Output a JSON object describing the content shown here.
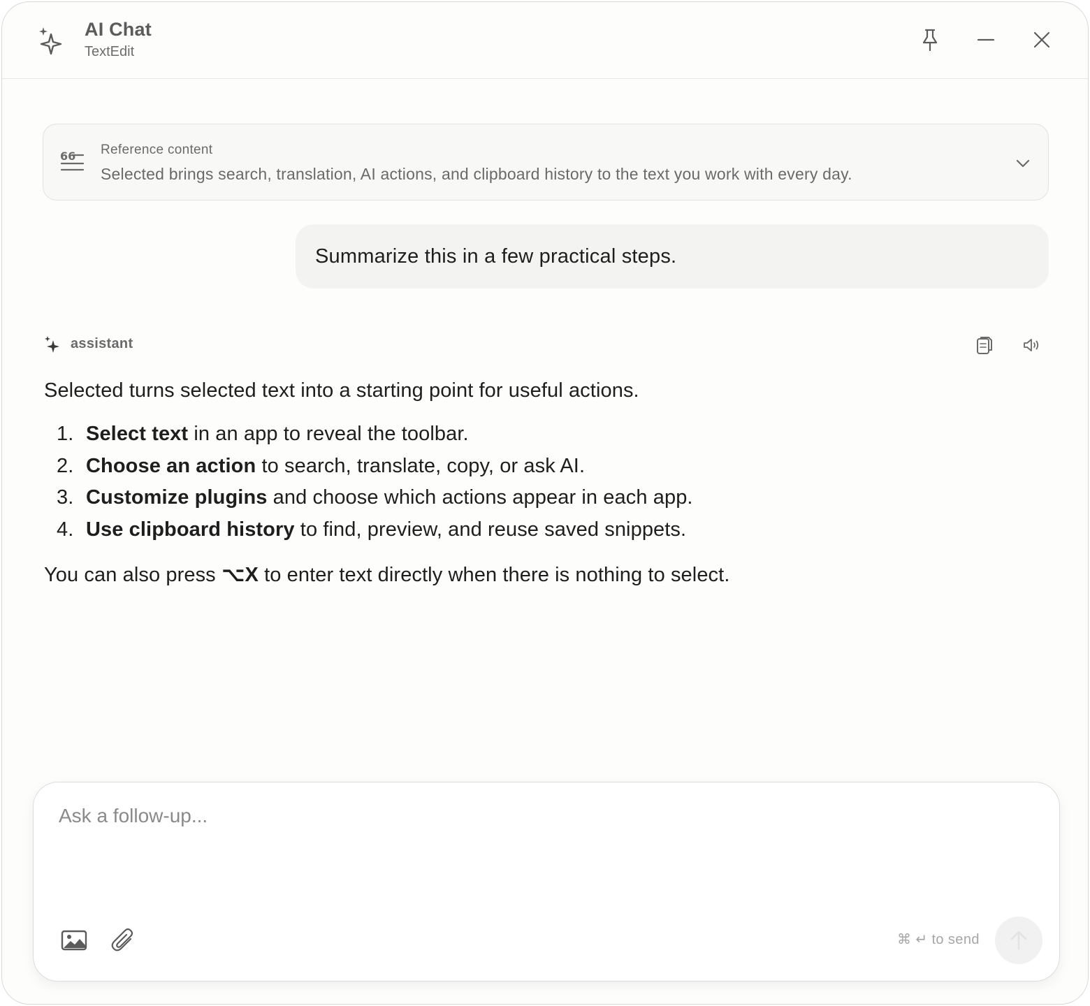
{
  "header": {
    "title": "AI Chat",
    "subtitle": "TextEdit",
    "icons": {
      "app": "sparkles-icon",
      "pin": "pin-icon",
      "minimize": "minimize-icon",
      "close": "close-icon"
    }
  },
  "reference": {
    "label": "Reference content",
    "text": "Selected brings search, translation, AI actions, and clipboard history to the text you work with every day.",
    "icons": {
      "quote": "quote-icon",
      "expand": "chevron-down-icon"
    }
  },
  "user_message": {
    "text": "Summarize this in a few practical steps."
  },
  "assistant": {
    "role": "assistant",
    "intro": "Selected turns selected text into a starting point for useful actions.",
    "steps": [
      {
        "number": "1.",
        "bold": "Select text",
        "rest": " in an app to reveal the toolbar."
      },
      {
        "number": "2.",
        "bold": "Choose an action",
        "rest": " to search, translate, copy, or ask AI."
      },
      {
        "number": "3.",
        "bold": "Customize plugins",
        "rest": " and choose which actions appear in each app."
      },
      {
        "number": "4.",
        "bold": "Use clipboard history",
        "rest": " to find, preview, and reuse saved snippets."
      }
    ],
    "outro_before": "You can also press ",
    "outro_shortcut": "⌥X",
    "outro_after": " to enter text directly when there is nothing to select.",
    "icons": {
      "avatar": "sparkle-icon",
      "copy": "copy-icon",
      "speak": "speaker-icon"
    }
  },
  "composer": {
    "placeholder": "Ask a follow-up...",
    "value": "",
    "send_hint": "⌘ ↵ to send",
    "icons": {
      "image": "image-icon",
      "attach": "paperclip-icon",
      "send": "arrow-up-icon"
    }
  },
  "colors": {
    "window_bg": "#fdfdfc",
    "muted_text": "#6a6a6a",
    "body_text": "#1e1e1e",
    "bubble_bg": "#f3f3f2",
    "send_disabled_bg": "#f1f1f1"
  }
}
